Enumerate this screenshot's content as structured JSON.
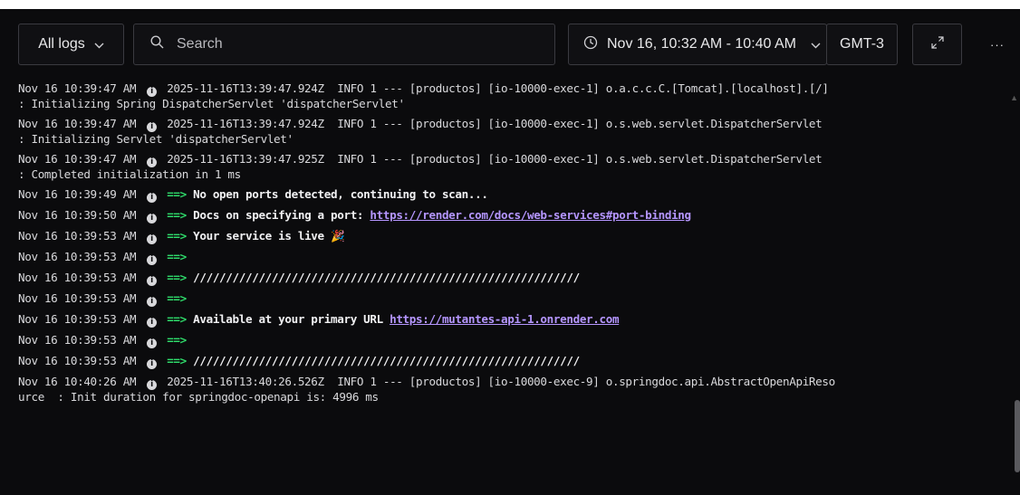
{
  "toolbar": {
    "filter_label": "All logs",
    "search_placeholder": "Search",
    "time_range": "Nov 16, 10:32 AM - 10:40 AM",
    "timezone": "GMT-3",
    "more_label": "···"
  },
  "logs": [
    {
      "ts": "Nov 16 10:39:47 AM",
      "line1": "2025-11-16T13:39:47.924Z  INFO 1 --- [productos] [io-10000-exec-1] o.a.c.c.C.[Tomcat].[localhost].[/]",
      "line2": ": Initializing Spring DispatcherServlet 'dispatcherServlet'"
    },
    {
      "ts": "Nov 16 10:39:47 AM",
      "line1": "2025-11-16T13:39:47.924Z  INFO 1 --- [productos] [io-10000-exec-1] o.s.web.servlet.DispatcherServlet",
      "line2": ": Initializing Servlet 'dispatcherServlet'"
    },
    {
      "ts": "Nov 16 10:39:47 AM",
      "line1": "2025-11-16T13:39:47.925Z  INFO 1 --- [productos] [io-10000-exec-1] o.s.web.servlet.DispatcherServlet",
      "line2": ": Completed initialization in 1 ms"
    },
    {
      "ts": "Nov 16 10:39:49 AM",
      "arrow": "==>",
      "text": "No open ports detected, continuing to scan..."
    },
    {
      "ts": "Nov 16 10:39:50 AM",
      "arrow": "==>",
      "text": "Docs on specifying a port: ",
      "link": "https://render.com/docs/web-services#port-binding"
    },
    {
      "ts": "Nov 16 10:39:53 AM",
      "arrow": "==>",
      "text": "Your service is live 🎉"
    },
    {
      "ts": "Nov 16 10:39:53 AM",
      "arrow": "==>",
      "text": ""
    },
    {
      "ts": "Nov 16 10:39:53 AM",
      "arrow": "==>",
      "text": "///////////////////////////////////////////////////////////"
    },
    {
      "ts": "Nov 16 10:39:53 AM",
      "arrow": "==>",
      "text": ""
    },
    {
      "ts": "Nov 16 10:39:53 AM",
      "arrow": "==>",
      "text": "Available at your primary URL ",
      "link": "https://mutantes-api-1.onrender.com"
    },
    {
      "ts": "Nov 16 10:39:53 AM",
      "arrow": "==>",
      "text": ""
    },
    {
      "ts": "Nov 16 10:39:53 AM",
      "arrow": "==>",
      "text": "///////////////////////////////////////////////////////////"
    },
    {
      "ts": "Nov 16 10:40:26 AM",
      "line1": "2025-11-16T13:40:26.526Z  INFO 1 --- [productos] [io-10000-exec-9] o.springdoc.api.AbstractOpenApiReso",
      "line2": "urce  : Init duration for springdoc-openapi is: 4996 ms"
    }
  ],
  "colors": {
    "arrow": "#2fdc6b",
    "link": "#b596ff",
    "background": "#0b0b0d"
  }
}
